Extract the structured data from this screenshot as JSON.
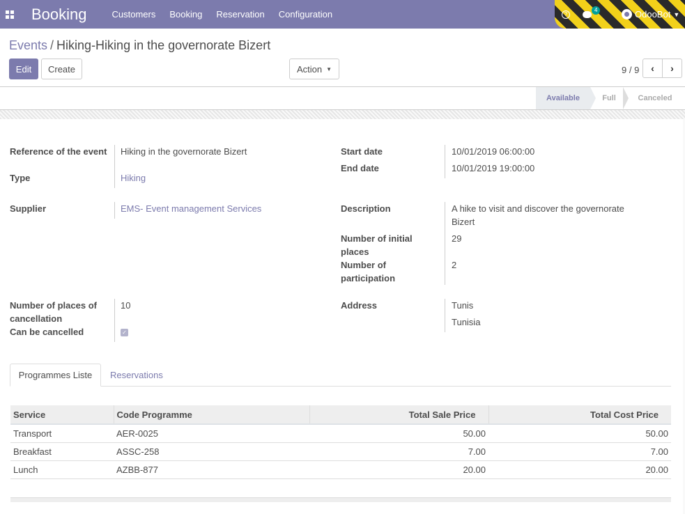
{
  "navbar": {
    "brand": "Booking",
    "menu": [
      "Customers",
      "Booking",
      "Reservation",
      "Configuration"
    ],
    "chat_count": "4",
    "user": "OdooBot",
    "help_glyph": "?"
  },
  "breadcrumb": {
    "parent": "Events",
    "separator": "/",
    "current": "Hiking-Hiking in the governorate Bizert"
  },
  "buttons": {
    "edit": "Edit",
    "create": "Create",
    "action": "Action"
  },
  "pager": {
    "text": "9 / 9"
  },
  "statusbar": {
    "stages": [
      "Available",
      "Full",
      "Canceled"
    ],
    "active": "Available"
  },
  "fields": {
    "reference_label": "Reference of the event",
    "reference_value": "Hiking in the governorate Bizert",
    "type_label": "Type",
    "type_value": "Hiking",
    "supplier_label": "Supplier",
    "supplier_value": "EMS- Event management Services",
    "places_cancel_label": "Number of places of cancellation",
    "places_cancel_value": "10",
    "can_cancel_label": "Can be cancelled",
    "can_cancel_checked": true,
    "start_label": "Start date",
    "start_value": "10/01/2019 06:00:00",
    "end_label": "End date",
    "end_value": "10/01/2019 19:00:00",
    "description_label": "Description",
    "description_value": "A hike to visit and discover the governorate Bizert",
    "initial_places_label": "Number of initial places",
    "initial_places_value": "29",
    "participation_label": "Number of participation",
    "participation_value": "2",
    "address_label": "Address",
    "address_city": "Tunis",
    "address_country": "Tunisia"
  },
  "tabs": [
    "Programmes Liste",
    "Reservations"
  ],
  "table": {
    "headers": [
      "Service",
      "Code Programme",
      "Total Sale Price",
      "Total Cost Price"
    ],
    "rows": [
      [
        "Transport",
        "AER-0025",
        "50.00",
        "50.00"
      ],
      [
        "Breakfast",
        "ASSC-258",
        "7.00",
        "7.00"
      ],
      [
        "Lunch",
        "AZBB-877",
        "20.00",
        "20.00"
      ]
    ]
  }
}
